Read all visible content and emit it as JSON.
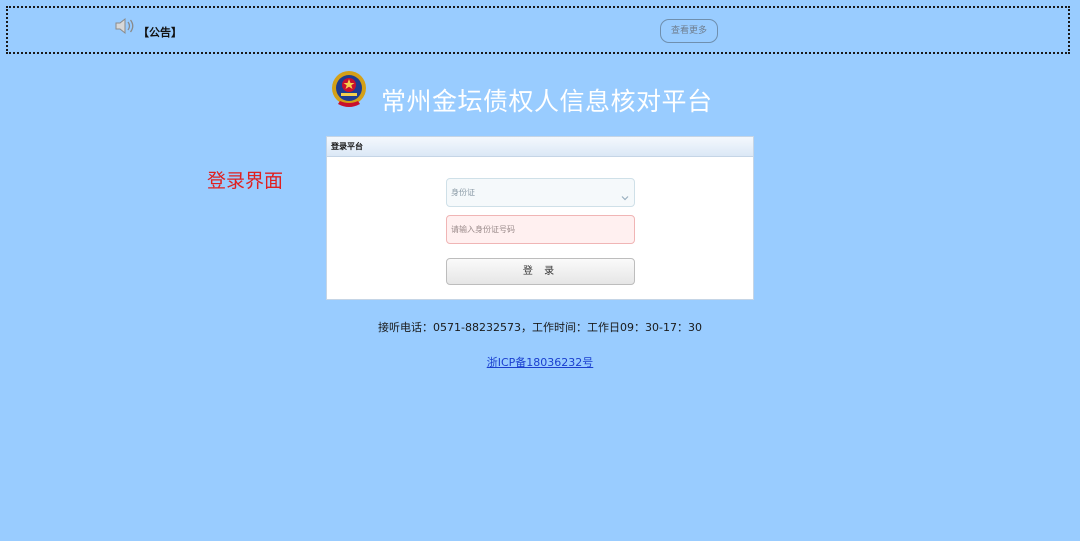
{
  "notice": {
    "label": "【公告】",
    "more_label": "查看更多"
  },
  "header": {
    "title": "常州金坛债权人信息核对平台"
  },
  "side_note": "登录界面",
  "login": {
    "panel_title": "登录平台",
    "id_type_value": "身份证",
    "id_number_placeholder": "请输入身份证号码",
    "submit_label": "登 录"
  },
  "footer": {
    "contact": "接听电话：0571-88232573，工作时间：工作日09：30-17：30",
    "icp": "浙ICP备18036232号"
  },
  "colors": {
    "background": "#99ccff",
    "side_note": "#e02020",
    "link": "#1a3fcf"
  },
  "icons": [
    "speaker-icon",
    "police-emblem-icon",
    "chevron-down-icon"
  ]
}
